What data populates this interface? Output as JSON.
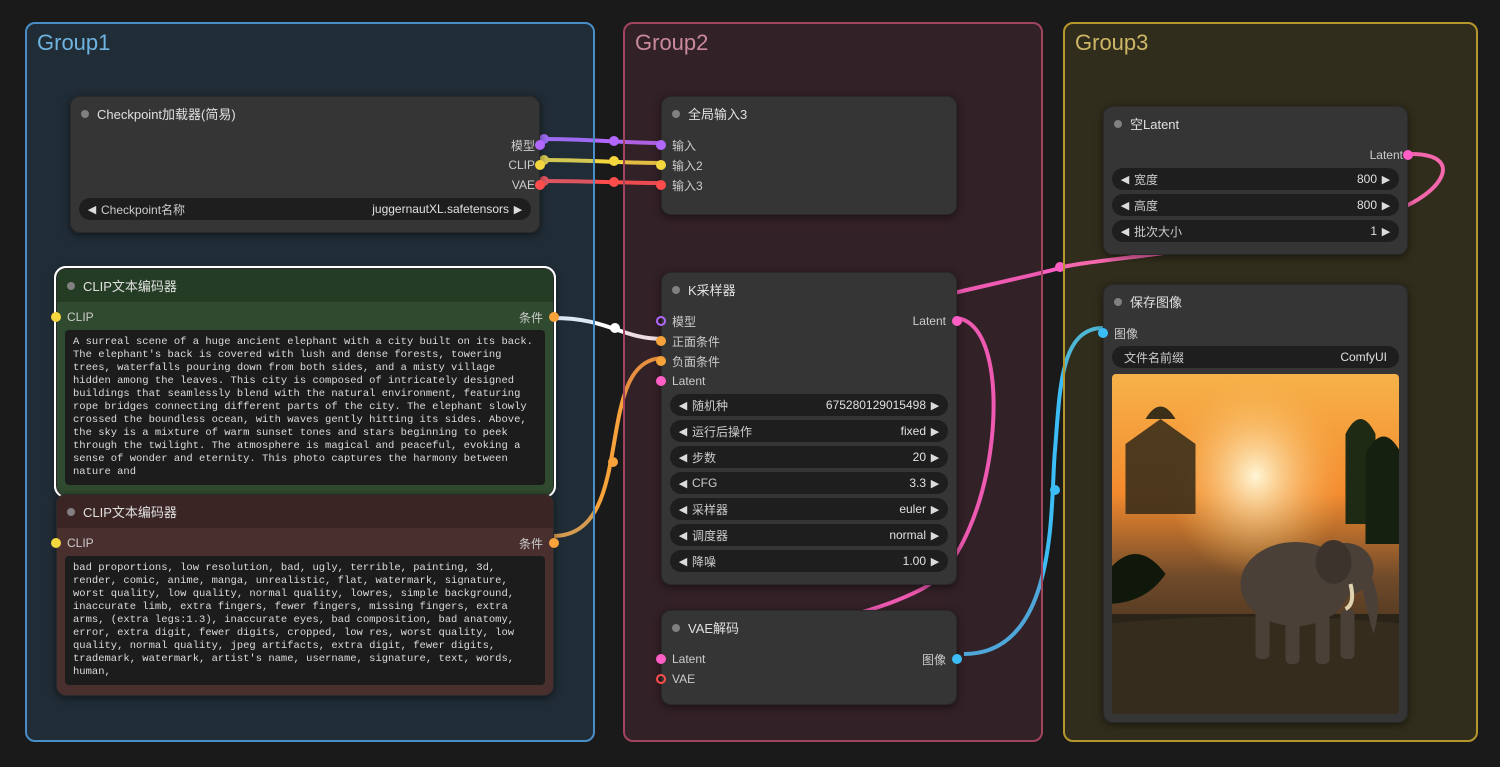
{
  "groups": {
    "g1": {
      "title": "Group1",
      "color": "#3f7fb6"
    },
    "g2": {
      "title": "Group2",
      "color": "#a1445e"
    },
    "g3": {
      "title": "Group3",
      "color": "#b5972b"
    }
  },
  "nodes": {
    "checkpoint": {
      "title": "Checkpoint加载器(简易)",
      "outputs": {
        "model": "模型",
        "clip": "CLIP",
        "vae": "VAE"
      },
      "widget": {
        "label": "Checkpoint名称",
        "value": "juggernautXL.safetensors"
      }
    },
    "clip_pos": {
      "title": "CLIP文本编码器",
      "input": "CLIP",
      "output": "条件",
      "text": "A surreal scene of a huge ancient elephant with a city built on its back. The elephant's back is covered with lush and dense forests, towering trees, waterfalls pouring down from both sides, and a misty village hidden among the leaves. This city is composed of intricately designed buildings that seamlessly blend with the natural environment, featuring rope bridges connecting different parts of the city. The elephant slowly crossed the boundless ocean, with waves gently hitting its sides. Above, the sky is a mixture of warm sunset tones and stars beginning to peek through the twilight. The atmosphere is magical and peaceful, evoking a sense of wonder and eternity. This photo captures the harmony between nature and"
    },
    "clip_neg": {
      "title": "CLIP文本编码器",
      "input": "CLIP",
      "output": "条件",
      "text": "bad proportions, low resolution, bad, ugly, terrible, painting, 3d, render, comic, anime, manga, unrealistic, flat, watermark, signature, worst quality, low quality, normal quality, lowres, simple background, inaccurate limb, extra fingers, fewer fingers, missing fingers, extra arms, (extra legs:1.3), inaccurate eyes, bad composition, bad anatomy, error, extra digit, fewer digits, cropped, low res, worst quality, low quality, normal quality, jpeg artifacts, extra digit, fewer digits, trademark, watermark, artist's name, username, signature, text, words, human,"
    },
    "reroute": {
      "title": "全局输入3",
      "inputs": {
        "in1": "输入",
        "in2": "输入2",
        "in3": "输入3"
      }
    },
    "ksampler": {
      "title": "K采样器",
      "inputs": {
        "model": "模型",
        "positive": "正面条件",
        "negative": "负面条件",
        "latent": "Latent"
      },
      "output": "Latent",
      "widgets": [
        {
          "label": "随机种",
          "value": "675280129015498"
        },
        {
          "label": "运行后操作",
          "value": "fixed"
        },
        {
          "label": "步数",
          "value": "20"
        },
        {
          "label": "CFG",
          "value": "3.3"
        },
        {
          "label": "采样器",
          "value": "euler"
        },
        {
          "label": "调度器",
          "value": "normal"
        },
        {
          "label": "降噪",
          "value": "1.00"
        }
      ]
    },
    "vae_decode": {
      "title": "VAE解码",
      "inputs": {
        "latent": "Latent",
        "vae": "VAE"
      },
      "output": "图像"
    },
    "empty_latent": {
      "title": "空Latent",
      "output": "Latent",
      "widgets": [
        {
          "label": "宽度",
          "value": "800"
        },
        {
          "label": "高度",
          "value": "800"
        },
        {
          "label": "批次大小",
          "value": "1"
        }
      ]
    },
    "save_image": {
      "title": "保存图像",
      "input": "图像",
      "widget": {
        "label": "文件名前缀",
        "value": "ComfyUI"
      }
    }
  },
  "colors": {
    "model": "#b267ff",
    "clip": "#f4d73e",
    "vae": "#ff4d4d",
    "cond_pos": "#ffffff",
    "cond_neg": "#f7a23b",
    "latent": "#ff5ec4",
    "image": "#3dbdf5"
  }
}
